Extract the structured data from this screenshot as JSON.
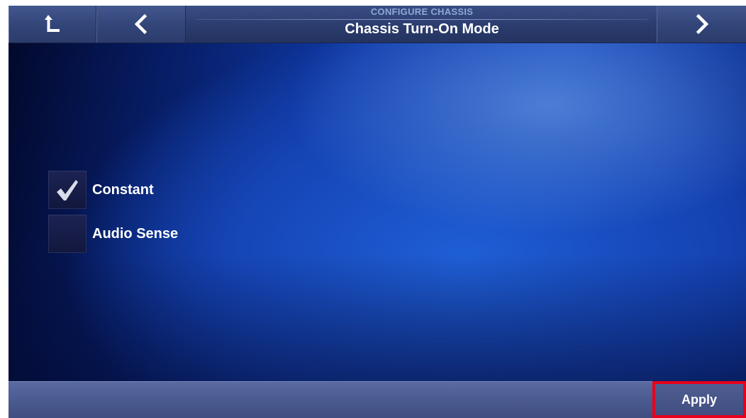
{
  "header": {
    "subtitle": "CONFIGURE CHASSIS",
    "title": "Chassis Turn-On Mode",
    "nav": {
      "up_icon": "up-arrow-icon",
      "back_icon": "chevron-left-icon",
      "next_icon": "chevron-right-icon"
    }
  },
  "options": [
    {
      "label": "Constant",
      "checked": true
    },
    {
      "label": "Audio Sense",
      "checked": false
    }
  ],
  "footer": {
    "apply_label": "Apply"
  },
  "colors": {
    "highlight": "#e8001c",
    "background_blue": "#1748bf",
    "checkbox_bg": "#12173d"
  }
}
